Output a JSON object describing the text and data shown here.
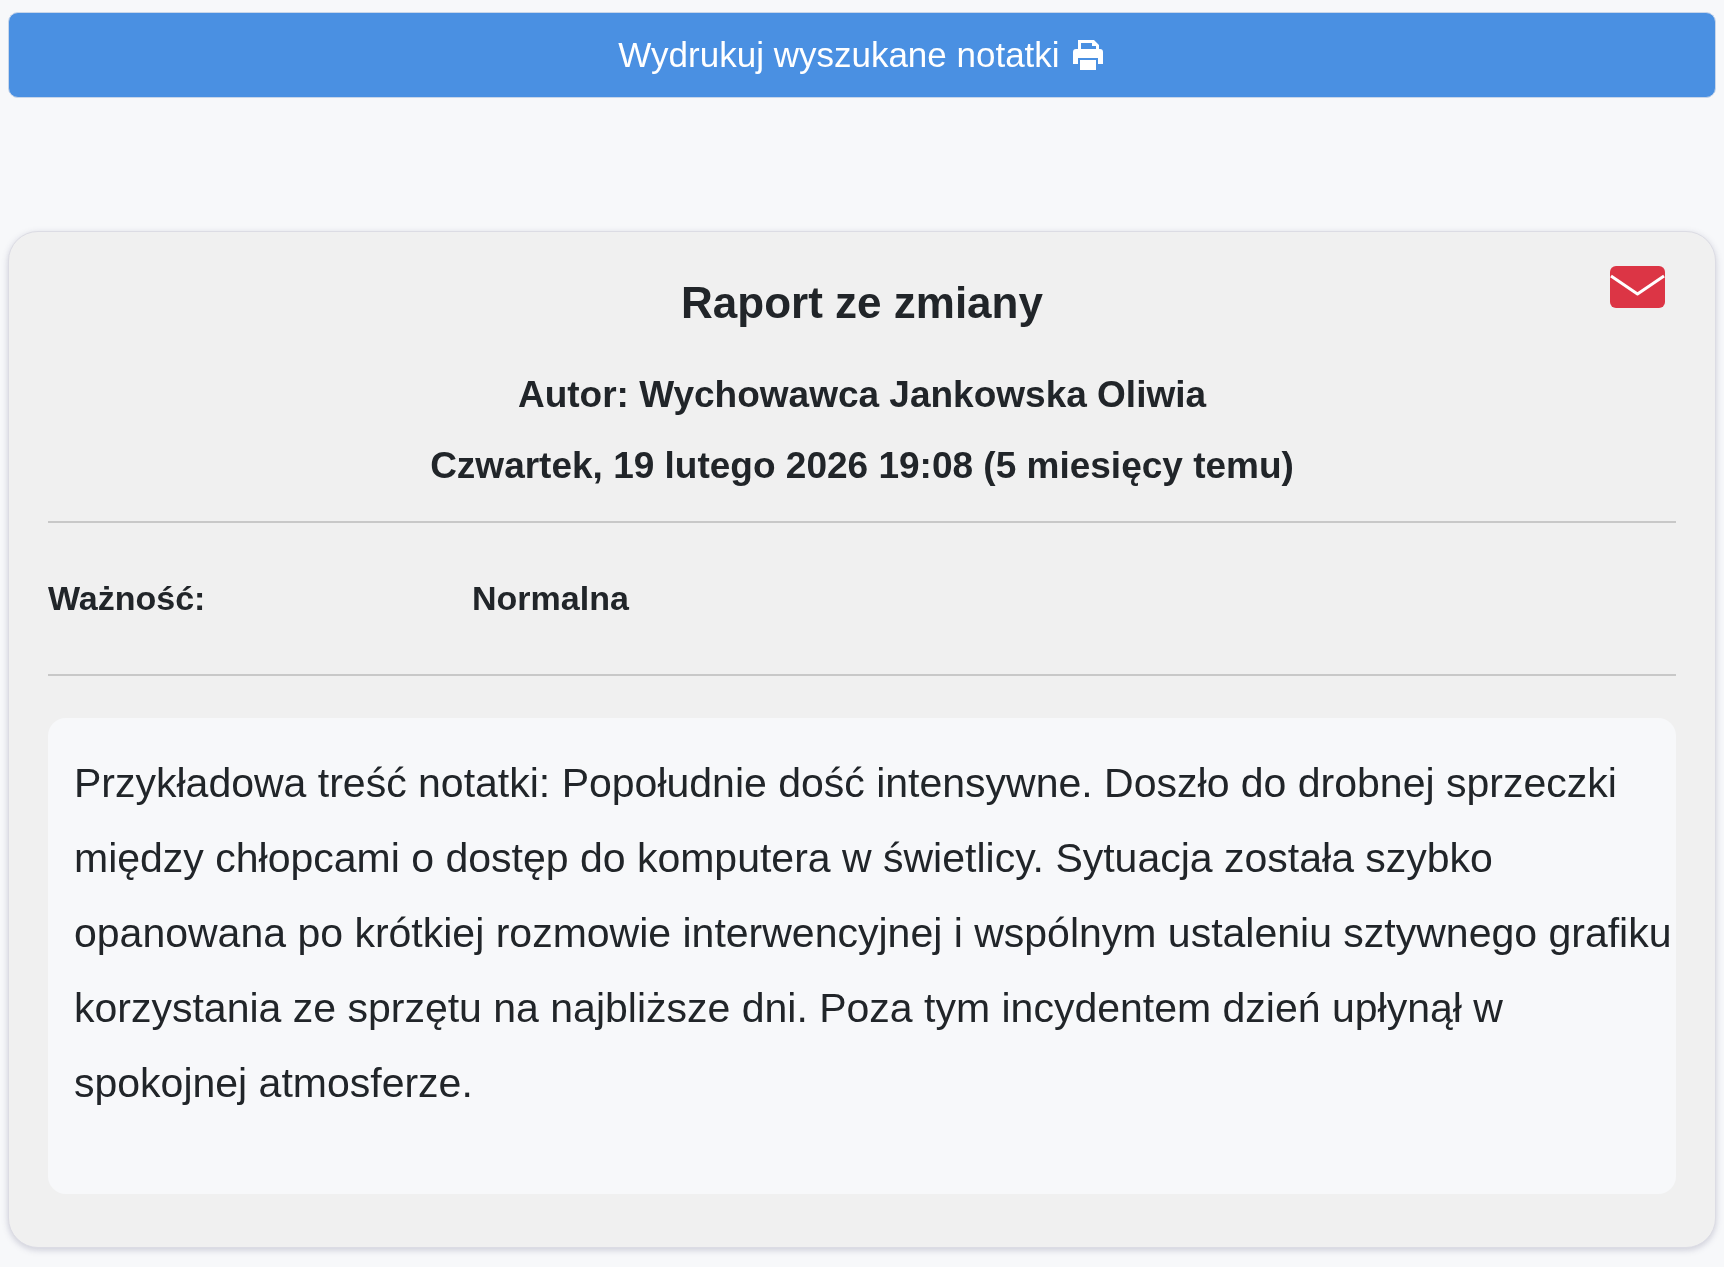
{
  "print_button": {
    "label": "Wydrukuj wyszukane notatki"
  },
  "note": {
    "title": "Raport ze zmiany",
    "author": "Autor: Wychowawca Jankowska Oliwia",
    "date": "Czwartek, 19 lutego 2026 19:08 (5 miesięcy temu)",
    "fields": [
      {
        "label": "Ważność:",
        "value": "Normalna"
      }
    ],
    "body": "Przykładowa treść notatki: Popołudnie dość intensywne. Doszło do drobnej sprzeczki między chłopcami o dostęp do komputera w świetlicy. Sytuacja została szybko opanowana po krótkiej rozmowie interwencyjnej i wspólnym ustaleniu sztywnego grafiku korzystania ze sprzętu na najbliższe dni. Poza tym incydentem dzień upłynął w spokojnej atmosferze."
  }
}
